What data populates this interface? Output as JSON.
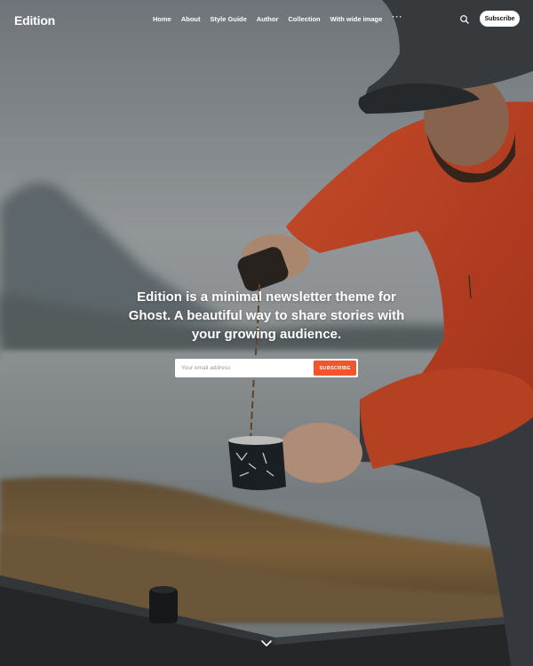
{
  "site": {
    "logo": "Edition"
  },
  "nav": {
    "items": [
      {
        "label": "Home"
      },
      {
        "label": "About"
      },
      {
        "label": "Style Guide"
      },
      {
        "label": "Author"
      },
      {
        "label": "Collection"
      },
      {
        "label": "With wide image"
      }
    ],
    "more_label": "···",
    "search_icon": "search-icon",
    "subscribe_label": "Subscribe"
  },
  "hero": {
    "headline": "Edition is a minimal newsletter theme for Ghost. A beautiful way to share stories with your growing audience.",
    "email_placeholder": "Your email address",
    "submit_label": "SUBSCRIBE",
    "scroll_icon": "chevron-down-icon"
  },
  "colors": {
    "accent": "#f2542d",
    "header_text": "#ffffff",
    "jacket": "#d94a2a"
  }
}
